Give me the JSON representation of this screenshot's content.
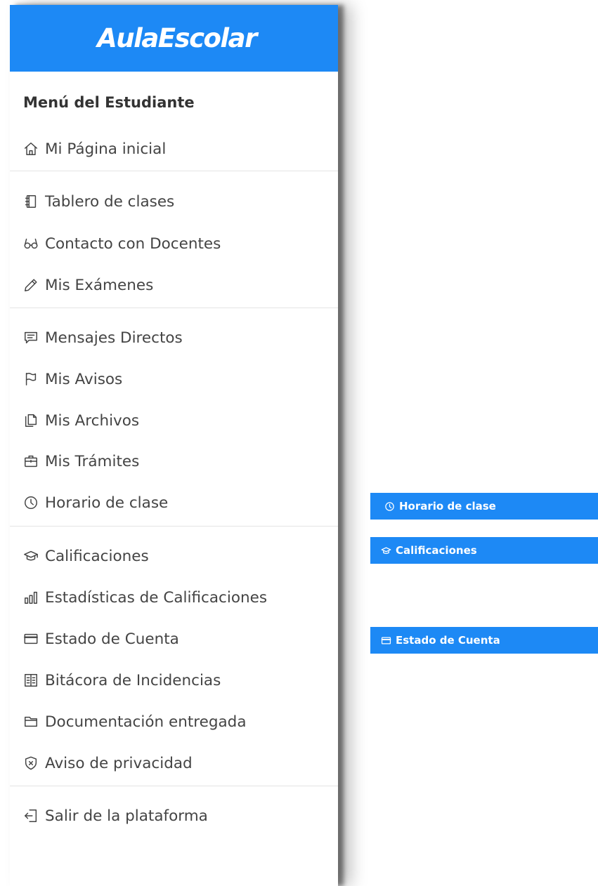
{
  "brand": {
    "title": "AulaEscolar",
    "color": "#1d89f5"
  },
  "menu": {
    "title": "Menú del Estudiante",
    "items": [
      {
        "label": "Mi Página inicial",
        "icon": "home-icon"
      },
      {
        "label": "Tablero de clases",
        "icon": "notebook-icon"
      },
      {
        "label": "Contacto con Docentes",
        "icon": "glasses-icon"
      },
      {
        "label": "Mis Exámenes",
        "icon": "pencil-icon"
      },
      {
        "label": "Mensajes Directos",
        "icon": "message-icon"
      },
      {
        "label": "Mis Avisos",
        "icon": "flag-icon"
      },
      {
        "label": "Mis Archivos",
        "icon": "files-icon"
      },
      {
        "label": "Mis Trámites",
        "icon": "briefcase-icon"
      },
      {
        "label": "Horario de clase",
        "icon": "clock-icon"
      },
      {
        "label": "Calificaciones",
        "icon": "graduation-cap-icon"
      },
      {
        "label": "Estadísticas de Calificaciones",
        "icon": "bar-chart-icon"
      },
      {
        "label": "Estado de Cuenta",
        "icon": "credit-card-icon"
      },
      {
        "label": "Bitácora de Incidencias",
        "icon": "book-open-icon"
      },
      {
        "label": "Documentación entregada",
        "icon": "folder-icon"
      },
      {
        "label": "Aviso de privacidad",
        "icon": "shield-x-icon"
      },
      {
        "label": "Salir de la plataforma",
        "icon": "logout-icon"
      }
    ]
  },
  "chips": [
    {
      "label": "Horario de clase",
      "icon": "clock-icon"
    },
    {
      "label": "Calificaciones",
      "icon": "graduation-cap-icon"
    },
    {
      "label": "Estado de Cuenta",
      "icon": "credit-card-icon"
    }
  ]
}
